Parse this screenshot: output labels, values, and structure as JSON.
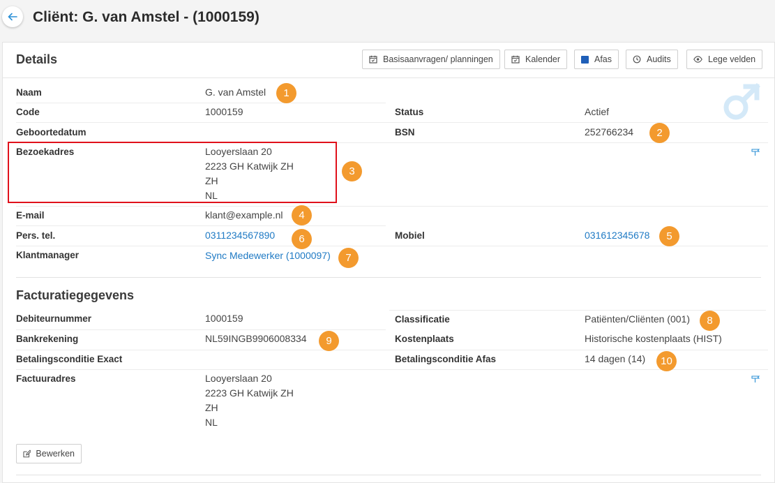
{
  "header": {
    "title": "Cliënt: G. van Amstel - (1000159)"
  },
  "details": {
    "title": "Details",
    "toolbar": {
      "basis": "Basisaanvragen/ planningen",
      "kalender": "Kalender",
      "afas": "Afas",
      "audits": "Audits",
      "lege": "Lege velden"
    },
    "naam_label": "Naam",
    "naam": "G. van Amstel",
    "code_label": "Code",
    "code": "1000159",
    "status_label": "Status",
    "status": "Actief",
    "geboorte_label": "Geboortedatum",
    "geboorte": "",
    "bsn_label": "BSN",
    "bsn": "252766234",
    "bezoek_label": "Bezoekadres",
    "bezoek": [
      "Looyerslaan 20",
      "2223 GH Katwijk ZH",
      "ZH",
      "NL"
    ],
    "email_label": "E-mail",
    "email": "klant@example.nl",
    "perstel_label": "Pers. tel.",
    "perstel": "0311234567890",
    "mobiel_label": "Mobiel",
    "mobiel": "031612345678",
    "km_label": "Klantmanager",
    "km": "Sync Medewerker (1000097)"
  },
  "billing": {
    "title": "Facturatiegegevens",
    "deb_label": "Debiteurnummer",
    "deb": "1000159",
    "class_label": "Classificatie",
    "class": "Patiënten/Cliënten (001)",
    "bank_label": "Bankrekening",
    "bank": "NL59INGB9906008334",
    "kosten_label": "Kostenplaats",
    "kosten": "Historische kostenplaats (HIST)",
    "bce_label": "Betalingsconditie Exact",
    "bce": "",
    "bca_label": "Betalingsconditie Afas",
    "bca": "14 dagen (14)",
    "fact_label": "Factuuradres",
    "fact": [
      "Looyerslaan 20",
      "2223 GH Katwijk ZH",
      "ZH",
      "NL"
    ]
  },
  "edit_label": "Bewerken",
  "badges": [
    "1",
    "2",
    "3",
    "4",
    "5",
    "6",
    "7",
    "8",
    "9",
    "10"
  ],
  "colors": {
    "accent": "#f39a2e",
    "link": "#1f7ac4",
    "highlight": "#e0111b"
  },
  "icons": [
    "arrow-left-icon",
    "calendar-icon",
    "clock-history-icon",
    "eye-icon",
    "male-gender-icon",
    "map-signpost-icon",
    "edit-icon"
  ]
}
